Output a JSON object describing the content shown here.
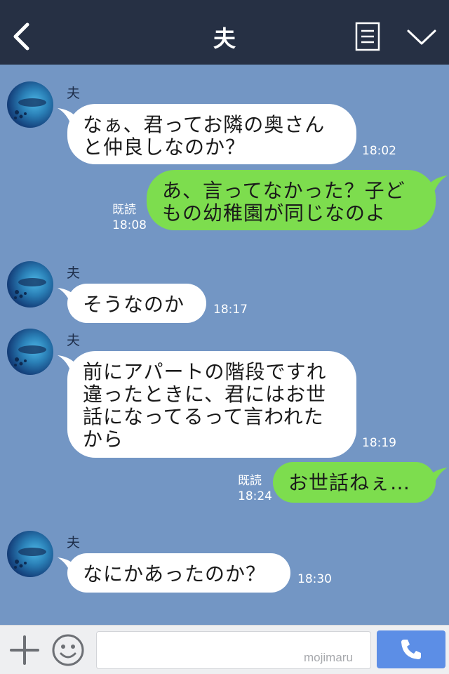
{
  "header": {
    "title": "夫",
    "back_icon": "chevron-left-icon",
    "notes_icon": "notes-icon",
    "menu_icon": "chevron-down-icon",
    "background": "#263044"
  },
  "messages": [
    {
      "side": "left",
      "sender": "夫",
      "text": "なぁ、君ってお隣の奥さん\nと仲良しなのか？",
      "time": "18:02"
    },
    {
      "side": "right",
      "read": "既読",
      "time": "18:08",
      "text": "あ、言ってなかった？子ど\nもの幼稚園が同じなのよ"
    },
    {
      "side": "left",
      "sender": "夫",
      "text": "そうなのか",
      "time": "18:17"
    },
    {
      "side": "left",
      "sender": "夫",
      "text": "前にアパートの階段ですれ\n違ったときに、君にはお世\n話になってるって言われた\nから",
      "time": "18:19"
    },
    {
      "side": "right",
      "read": "既読",
      "time": "18:24",
      "text": "お世話ねぇ…"
    },
    {
      "side": "left",
      "sender": "夫",
      "text": "なにかあったのか？",
      "time": "18:30"
    }
  ],
  "footer": {
    "plus_icon": "plus-icon",
    "emoji_icon": "smiley-icon",
    "input_value": "",
    "watermark": "mojimaru",
    "call_icon": "phone-icon"
  },
  "colors": {
    "chat_background": "#7396c4",
    "incoming_bubble": "#ffffff",
    "outgoing_bubble": "#7ddd4e",
    "call_button": "#5c8ee6"
  }
}
